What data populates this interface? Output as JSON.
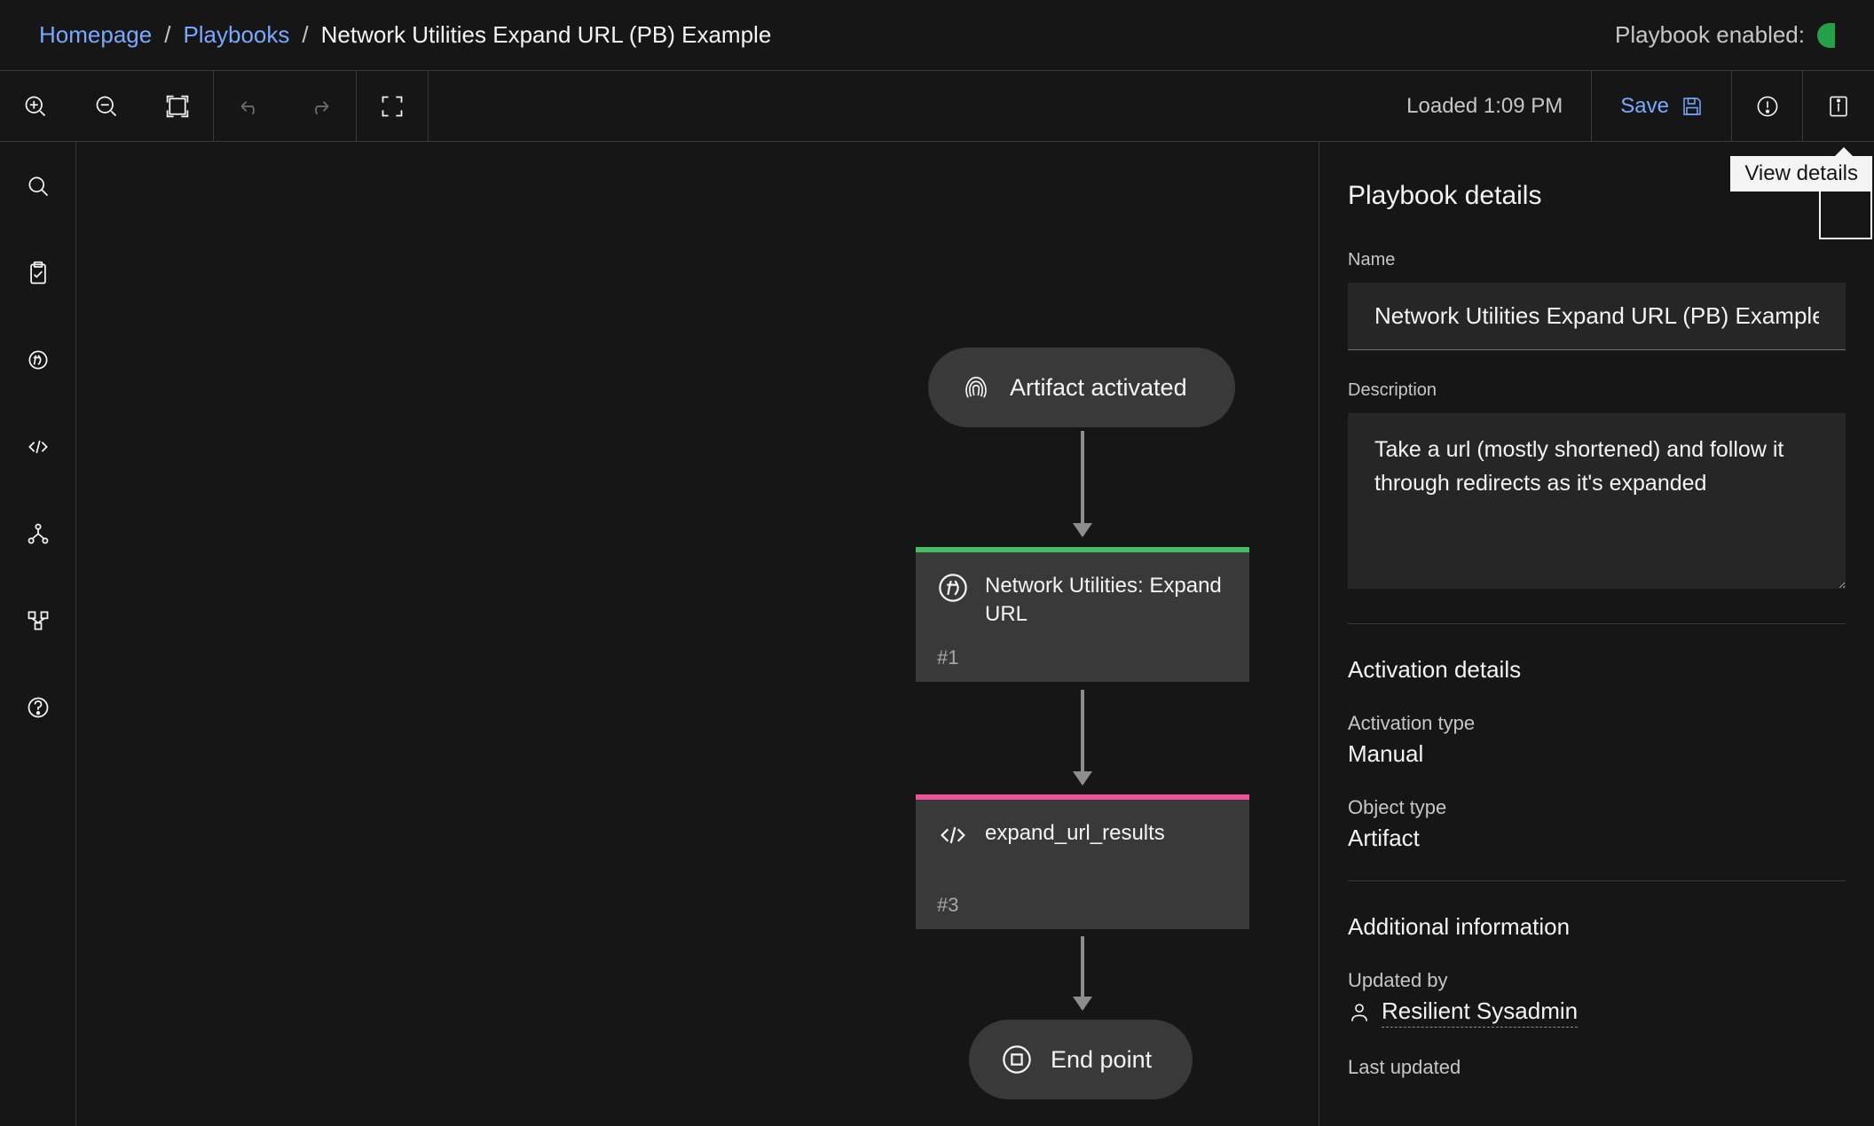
{
  "breadcrumb": {
    "home": "Homepage",
    "playbooks": "Playbooks",
    "current": "Network Utilities Expand URL (PB) Example"
  },
  "header": {
    "enabled_label": "Playbook enabled:"
  },
  "toolbar": {
    "loaded": "Loaded 1:09 PM",
    "save": "Save"
  },
  "tooltip": {
    "view_details": "View details"
  },
  "flow": {
    "start": "Artifact activated",
    "node1": {
      "title": "Network Utilities: Expand URL",
      "num": "#1"
    },
    "node2": {
      "title": "expand_url_results",
      "num": "#3"
    },
    "end": "End point"
  },
  "panel": {
    "title": "Playbook details",
    "name_label": "Name",
    "name_value": "Network Utilities Expand URL (PB) Example",
    "desc_label": "Description",
    "desc_value": "Take a url (mostly shortened) and follow it through redirects as it's expanded",
    "activation_title": "Activation details",
    "activation_type_label": "Activation type",
    "activation_type_value": "Manual",
    "object_type_label": "Object type",
    "object_type_value": "Artifact",
    "additional_title": "Additional information",
    "updated_by_label": "Updated by",
    "updated_by_value": "Resilient Sysadmin",
    "last_updated_label": "Last updated"
  }
}
